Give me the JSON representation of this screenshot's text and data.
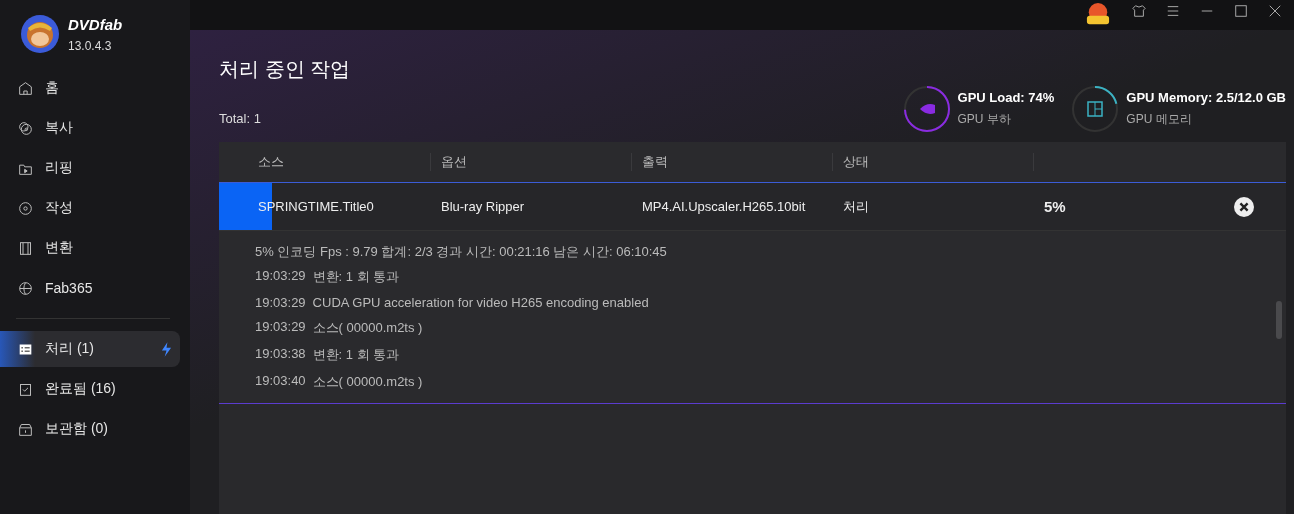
{
  "app": {
    "name": "DVDfab",
    "version": "13.0.4.3"
  },
  "sidebar": {
    "items": [
      {
        "label": "홈",
        "selected": false
      },
      {
        "label": "복사",
        "selected": false
      },
      {
        "label": "리핑",
        "selected": false
      },
      {
        "label": "작성",
        "selected": false
      },
      {
        "label": "변환",
        "selected": false
      },
      {
        "label": "Fab365",
        "selected": false
      }
    ],
    "queue": [
      {
        "label": "처리 (1)",
        "selected": true,
        "boost": true
      },
      {
        "label": "완료됨 (16)",
        "selected": false,
        "boost": false
      },
      {
        "label": "보관함 (0)",
        "selected": false,
        "boost": false
      }
    ]
  },
  "title": "처리 중인 작업",
  "total": "Total: 1",
  "gpu": [
    {
      "kind": "load",
      "title": "GPU Load: 74%",
      "subtitle": "GPU 부하"
    },
    {
      "kind": "memory",
      "title": "GPU Memory: 2.5/12.0 GB",
      "subtitle": "GPU 메모리"
    }
  ],
  "table": {
    "columns": [
      "소스",
      "옵션",
      "출력",
      "상태"
    ],
    "rows": [
      {
        "source": "SPRINGTIME.Title0",
        "option": "Blu-ray Ripper",
        "output": "MP4.AI.Upscaler.H265.10bit",
        "status": "처리",
        "percent": "5%",
        "level": 0.05
      }
    ]
  },
  "progress_line": "5%  인코딩 Fps : 9.79  합계: 2/3  경과 시간: 00:21:16  남은 시간: 06:10:45",
  "log": [
    {
      "time": "19:03:29",
      "text": "변환: 1 회 통과"
    },
    {
      "time": "19:03:29",
      "text": "CUDA GPU acceleration for video H265 encoding enabled"
    },
    {
      "time": "19:03:29",
      "text": "소스( 00000.m2ts )"
    },
    {
      "time": "19:03:38",
      "text": "변환: 1 회 통과"
    },
    {
      "time": "19:03:40",
      "text": "소스( 00000.m2ts )"
    }
  ]
}
